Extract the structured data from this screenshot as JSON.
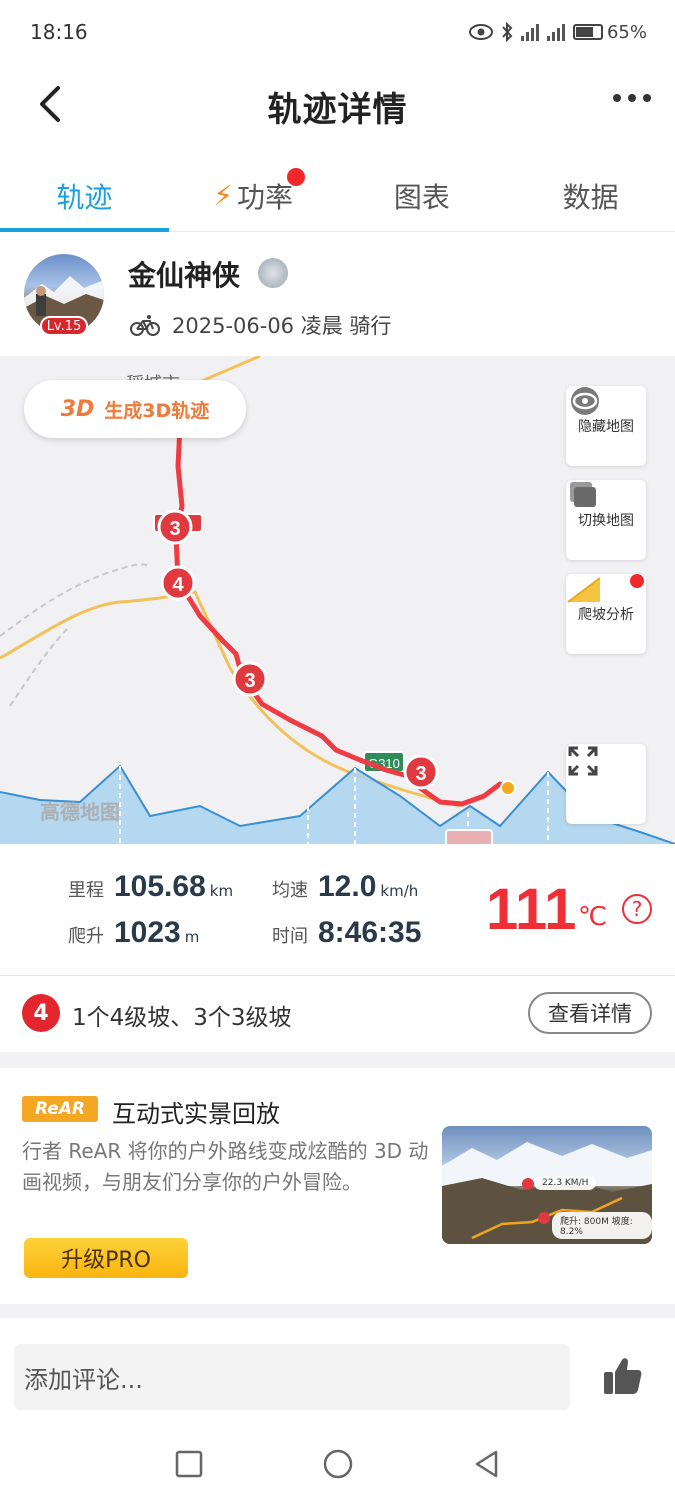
{
  "status": {
    "time": "18:16",
    "battery": "65%"
  },
  "header": {
    "title": "轨迹详情"
  },
  "tabs": [
    {
      "label": "轨迹"
    },
    {
      "label": "功率"
    },
    {
      "label": "图表"
    },
    {
      "label": "数据"
    }
  ],
  "profile": {
    "name": "金仙神侠",
    "level": "Lv.15",
    "meta": "2025-06-06 凌晨 骑行"
  },
  "map": {
    "btn_3d_icon": "3D",
    "btn_3d_label": "生成3D轨迹",
    "hide_map": "隐藏地图",
    "switch_map": "切换地图",
    "climb_analysis": "爬坡分析",
    "watermark": "高德地图",
    "city_label": "稻城市",
    "road_label": "G310",
    "climb_markers": [
      "3",
      "4",
      "3",
      "3"
    ]
  },
  "stats": {
    "distance_label": "里程",
    "distance": "105.68",
    "distance_unit": "km",
    "speed_label": "均速",
    "speed": "12.0",
    "speed_unit": "km/h",
    "climb_label": "爬升",
    "climb": "1023",
    "climb_unit": "m",
    "time_label": "时间",
    "time": "8:46:35",
    "temperature": "111",
    "temperature_unit": "℃",
    "help": "?"
  },
  "climbs": {
    "badge": "4",
    "summary": "1个4级坡、3个3级坡",
    "detail_button": "查看详情"
  },
  "promo": {
    "badge": "ReAR",
    "title": "互动式实景回放",
    "description": "行者 ReAR 将你的户外路线变成炫酷的 3D 动画视频，与朋友们分享你的户外冒险。",
    "upgrade_button": "升级PRO",
    "thumb_speed": "22.3 KM/H",
    "thumb_climb": "爬升: 800M  坡度: 8.2%"
  },
  "comment": {
    "placeholder": "添加评论..."
  },
  "colors": {
    "accent": "#1aa0e0",
    "route": "#ef3b43",
    "temperature": "#ef2e35",
    "pro": "#f9b40f"
  }
}
